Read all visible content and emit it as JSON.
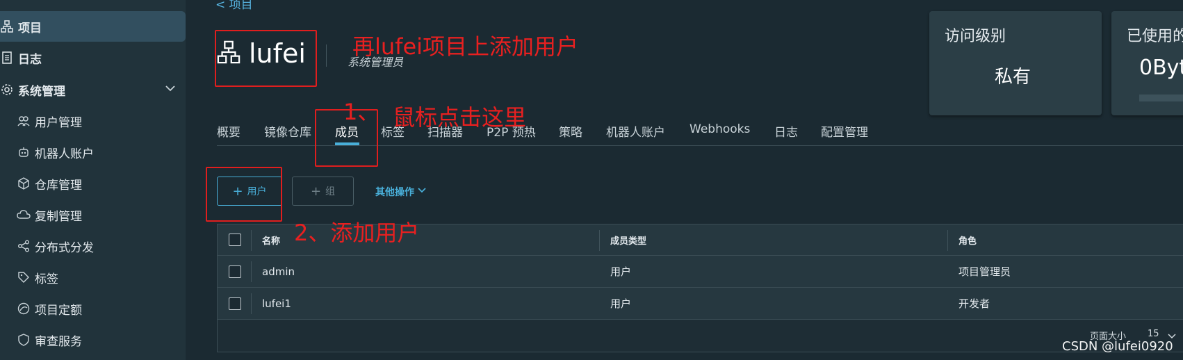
{
  "sidebar": {
    "items": [
      {
        "label": "项目",
        "icon": "project-icon"
      },
      {
        "label": "日志",
        "icon": "log-icon"
      },
      {
        "label": "系统管理",
        "icon": "admin-icon"
      },
      {
        "label": "用户管理",
        "icon": "users-icon"
      },
      {
        "label": "机器人账户",
        "icon": "robot-icon"
      },
      {
        "label": "仓库管理",
        "icon": "cube-icon"
      },
      {
        "label": "复制管理",
        "icon": "cloud-icon"
      },
      {
        "label": "分布式分发",
        "icon": "share-icon"
      },
      {
        "label": "标签",
        "icon": "tag-icon"
      },
      {
        "label": "项目定额",
        "icon": "gauge-icon"
      },
      {
        "label": "审查服务",
        "icon": "shield-icon"
      }
    ]
  },
  "header": {
    "back_label": "< 项目",
    "project_name": "lufei",
    "role": "系统管理员"
  },
  "cards": {
    "access": {
      "title": "访问级别",
      "value": "私有"
    },
    "usage": {
      "title": "已使用的",
      "value": "0Byt"
    }
  },
  "tabs": [
    "概要",
    "镜像仓库",
    "成员",
    "标签",
    "扫描器",
    "P2P 预热",
    "策略",
    "机器人账户",
    "Webhooks",
    "日志",
    "配置管理"
  ],
  "toolbar": {
    "add_user": "用户",
    "add_group": "组",
    "more_ops": "其他操作"
  },
  "table": {
    "headers": [
      "名称",
      "成员类型",
      "角色"
    ],
    "rows": [
      {
        "name": "admin",
        "type": "用户",
        "role": "项目管理员"
      },
      {
        "name": "lufei1",
        "type": "用户",
        "role": "开发者"
      }
    ],
    "page_size_label": "页面大小",
    "page_size_value": "15"
  },
  "annotations": {
    "title_note": "再lufei项目上添加用户",
    "step1_num": "1、",
    "step1_text": "鼠标点击这里",
    "step2_text": "2、添加用户"
  },
  "watermark": "CSDN @lufei0920"
}
